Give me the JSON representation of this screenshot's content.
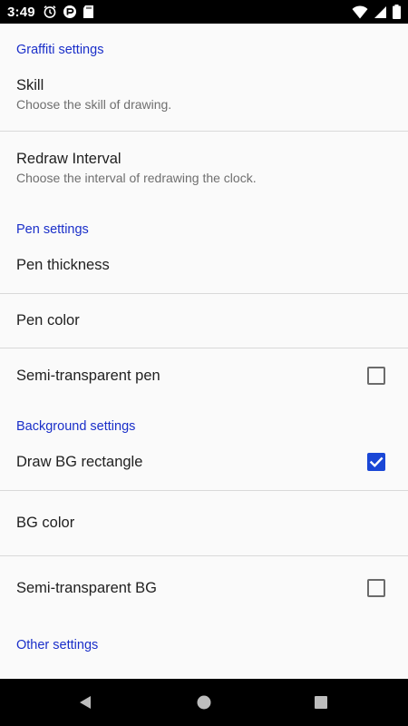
{
  "status_bar": {
    "time": "3:49",
    "left_icons": [
      "alarm-icon",
      "app-notification-icon",
      "sd-card-icon"
    ],
    "right_icons": [
      "wifi-icon",
      "cellular-signal-icon",
      "battery-icon"
    ]
  },
  "sections": {
    "graffiti": {
      "header": "Graffiti settings",
      "skill": {
        "title": "Skill",
        "summary": "Choose the skill of drawing."
      },
      "redraw": {
        "title": "Redraw Interval",
        "summary": "Choose the interval of redrawing the clock."
      }
    },
    "pen": {
      "header": "Pen settings",
      "thickness": {
        "title": "Pen thickness"
      },
      "color": {
        "title": "Pen color"
      },
      "semi_transparent": {
        "title": "Semi-transparent pen",
        "checked": false
      }
    },
    "background": {
      "header": "Background settings",
      "draw_rect": {
        "title": "Draw BG rectangle",
        "checked": true
      },
      "color": {
        "title": "BG color"
      },
      "semi_transparent": {
        "title": "Semi-transparent BG",
        "checked": false
      }
    },
    "other": {
      "header": "Other settings"
    }
  },
  "nav_bar": {
    "buttons": [
      "back-icon",
      "home-icon",
      "recents-icon"
    ]
  },
  "colors": {
    "accent": "#1a2fc9",
    "checkbox_checked": "#1a47d6",
    "background": "#fafafa",
    "divider": "#d9d9d9"
  }
}
